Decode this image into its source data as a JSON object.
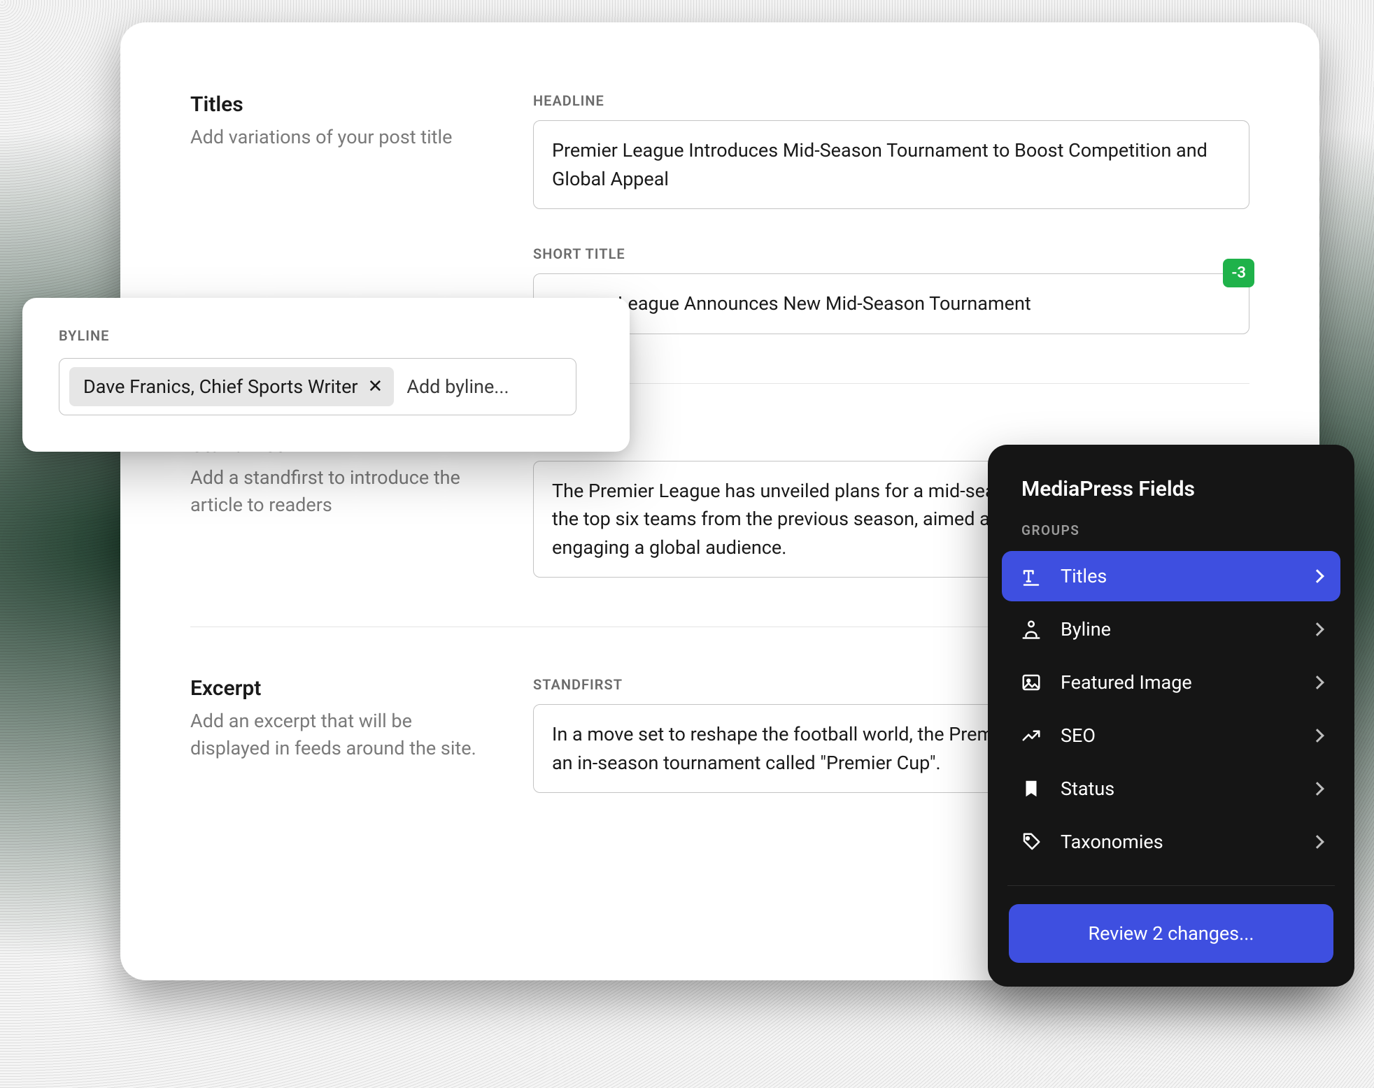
{
  "sections": {
    "titles": {
      "heading": "Titles",
      "desc": "Add variations of your post title"
    },
    "standfirst": {
      "heading": "Standfirst",
      "desc": "Add a standfirst to introduce the article to readers"
    },
    "excerpt": {
      "heading": "Excerpt",
      "desc": "Add an excerpt that will be displayed in feeds around the site."
    }
  },
  "fields": {
    "headline": {
      "label": "HEADLINE",
      "value": "Premier League Introduces Mid-Season Tournament to Boost Competition and Global Appeal"
    },
    "short_title": {
      "label": "SHORT TITLE",
      "value": "League Announces New Mid-Season Tournament",
      "badge": "-3"
    },
    "standfirst": {
      "label": "STANDFIRST",
      "value": "The Premier League has unveiled plans for a mid-season tournament featuring the top six teams from the previous season, aimed at boosting competition and engaging a global audience."
    },
    "excerpt": {
      "label": "STANDFIRST",
      "value": "In a move set to reshape the football world, the Premier League has announced an in-season tournament called \"Premier Cup\"."
    }
  },
  "byline": {
    "label": "BYLINE",
    "chip": "Dave Franics, Chief Sports Writer",
    "placeholder": "Add byline..."
  },
  "panel": {
    "title": "MediaPress Fields",
    "groups_label": "GROUPS",
    "items": [
      {
        "label": "Titles",
        "icon": "type",
        "active": true
      },
      {
        "label": "Byline",
        "icon": "person",
        "active": false
      },
      {
        "label": "Featured Image",
        "icon": "image",
        "active": false
      },
      {
        "label": "SEO",
        "icon": "trend",
        "active": false
      },
      {
        "label": "Status",
        "icon": "bookmark",
        "active": false
      },
      {
        "label": "Taxonomies",
        "icon": "tag",
        "active": false
      }
    ],
    "review_label": "Review 2 changes..."
  }
}
